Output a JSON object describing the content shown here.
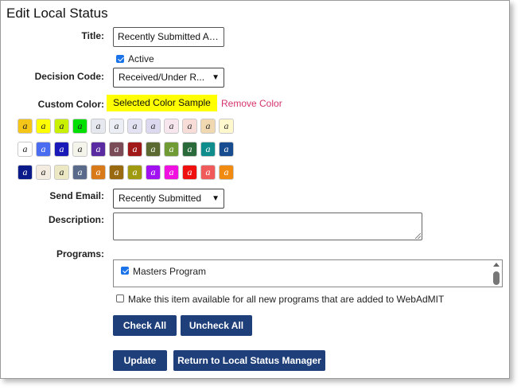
{
  "page": {
    "title": "Edit Local Status"
  },
  "form": {
    "title_label": "Title:",
    "title_value": "Recently Submitted App...",
    "active_label": "Active",
    "decision_code_label": "Decision Code:",
    "decision_code_value": "Received/Under R...",
    "custom_color_label": "Custom Color:",
    "color_sample_text": "Selected Color Sample",
    "remove_color": "Remove Color",
    "send_email_label": "Send Email:",
    "send_email_value": "Recently Submitted",
    "description_label": "Description:",
    "description_value": "",
    "programs_label": "Programs:",
    "program_item": "Masters Program",
    "new_programs_text": "Make this item available for all new programs that are added to WebAdMIT"
  },
  "buttons": {
    "check_all": "Check All",
    "uncheck_all": "Uncheck All",
    "update": "Update",
    "return": "Return to Local Status Manager"
  },
  "colors": {
    "selected_sample": "#ffff00",
    "remove_link": "#d6336c",
    "button_bg": "#1f3f7a"
  },
  "swatches": [
    [
      {
        "bg": "#f5c518",
        "fg": "#222"
      },
      {
        "bg": "#ffff00",
        "fg": "#222"
      },
      {
        "bg": "#c8f000",
        "fg": "#222"
      },
      {
        "bg": "#00e000",
        "fg": "#222"
      },
      {
        "bg": "#e6e8ef",
        "fg": "#333"
      },
      {
        "bg": "#eceef6",
        "fg": "#333"
      },
      {
        "bg": "#e2e2f2",
        "fg": "#333"
      },
      {
        "bg": "#dcd8f0",
        "fg": "#333"
      },
      {
        "bg": "#f8e6ee",
        "fg": "#333"
      },
      {
        "bg": "#f7dcd8",
        "fg": "#333"
      },
      {
        "bg": "#f0d9b0",
        "fg": "#333"
      },
      {
        "bg": "#fff8cc",
        "fg": "#333"
      }
    ],
    [
      {
        "bg": "#ffffff",
        "fg": "#222"
      },
      {
        "bg": "#4a6cf0",
        "fg": "#fff"
      },
      {
        "bg": "#1a1ab8",
        "fg": "#fff"
      },
      {
        "bg": "#f4f4ea",
        "fg": "#222"
      },
      {
        "bg": "#5a2aa0",
        "fg": "#fff"
      },
      {
        "bg": "#7a4c58",
        "fg": "#fff"
      },
      {
        "bg": "#a01818",
        "fg": "#fff"
      },
      {
        "bg": "#5a6a30",
        "fg": "#fff"
      },
      {
        "bg": "#6f9a34",
        "fg": "#fff"
      },
      {
        "bg": "#2a6a3a",
        "fg": "#fff"
      },
      {
        "bg": "#0f8c8c",
        "fg": "#fff"
      },
      {
        "bg": "#184c90",
        "fg": "#fff"
      }
    ],
    [
      {
        "bg": "#0a1a8a",
        "fg": "#fff"
      },
      {
        "bg": "#f4ece0",
        "fg": "#222"
      },
      {
        "bg": "#ece8c4",
        "fg": "#222"
      },
      {
        "bg": "#5a6a8a",
        "fg": "#fff"
      },
      {
        "bg": "#d97a1a",
        "fg": "#fff"
      },
      {
        "bg": "#9a6a10",
        "fg": "#fff"
      },
      {
        "bg": "#a09a10",
        "fg": "#fff"
      },
      {
        "bg": "#a010f0",
        "fg": "#fff"
      },
      {
        "bg": "#f010e0",
        "fg": "#fff"
      },
      {
        "bg": "#f01010",
        "fg": "#fff"
      },
      {
        "bg": "#f05a5a",
        "fg": "#fff"
      },
      {
        "bg": "#f08a10",
        "fg": "#fff"
      }
    ]
  ],
  "swatch_glyph": "a"
}
